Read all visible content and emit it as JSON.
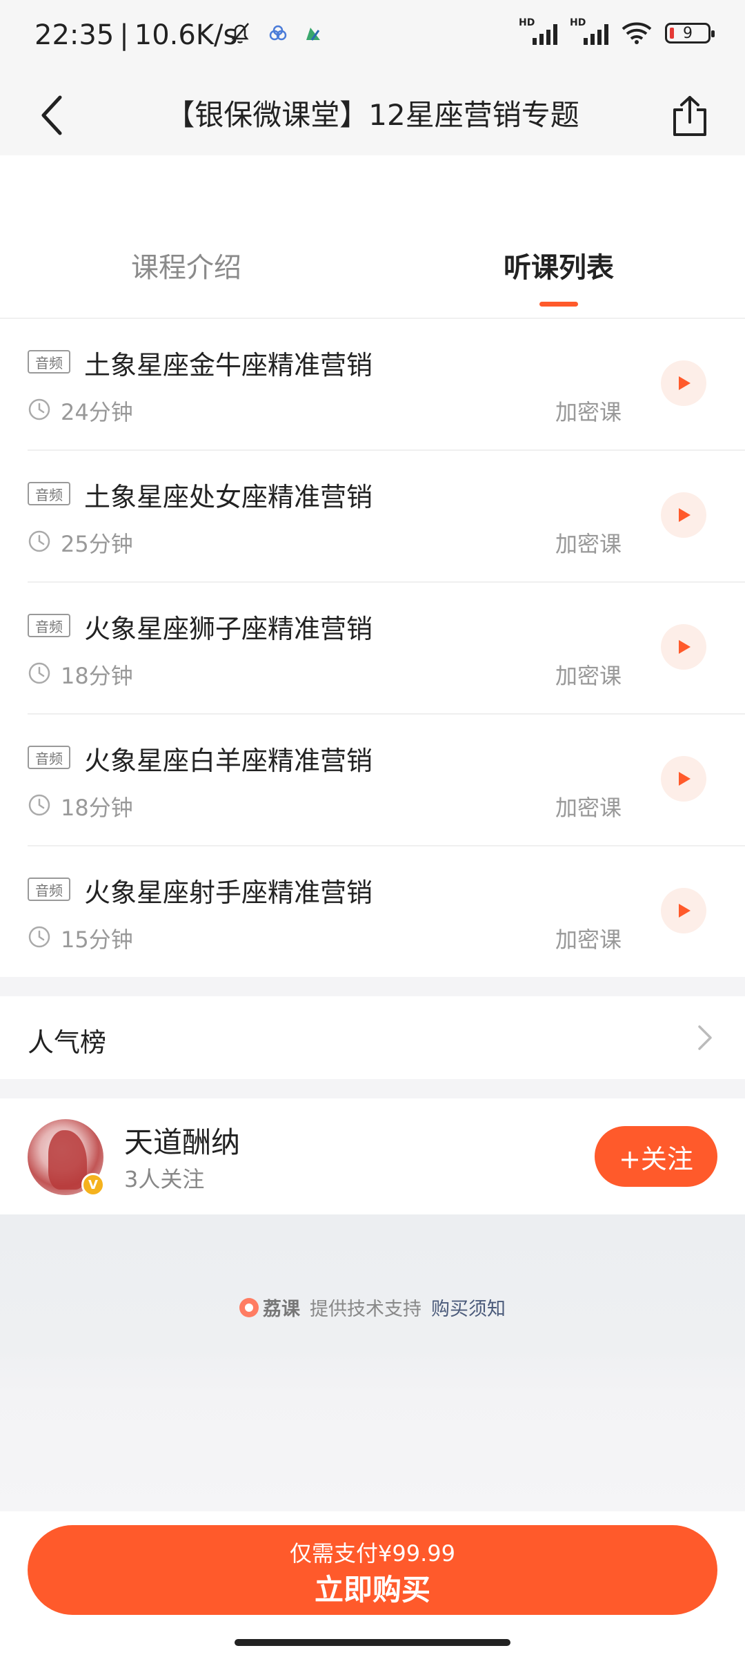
{
  "status_bar": {
    "time": "22:35",
    "network_speed": "10.6K/s",
    "battery_level": "9"
  },
  "header": {
    "title": "【银保微课堂】12星座营销专题"
  },
  "tabs": [
    {
      "label": "课程介绍",
      "active": false
    },
    {
      "label": "听课列表",
      "active": true
    }
  ],
  "lessons": [
    {
      "badge": "音频",
      "title": "土象星座金牛座精准营销",
      "duration": "24分钟",
      "tag": "加密课"
    },
    {
      "badge": "音频",
      "title": "土象星座处女座精准营销",
      "duration": "25分钟",
      "tag": "加密课"
    },
    {
      "badge": "音频",
      "title": "火象星座狮子座精准营销",
      "duration": "18分钟",
      "tag": "加密课"
    },
    {
      "badge": "音频",
      "title": "火象星座白羊座精准营销",
      "duration": "18分钟",
      "tag": "加密课"
    },
    {
      "badge": "音频",
      "title": "火象星座射手座精准营销",
      "duration": "15分钟",
      "tag": "加密课"
    }
  ],
  "popularity": {
    "label": "人气榜"
  },
  "author": {
    "name": "天道酬纳",
    "followers": "3人关注",
    "verified_badge": "V",
    "follow_label": "+关注"
  },
  "footer": {
    "brand": "荔课",
    "support_text": "提供技术支持",
    "notice_link": "购买须知"
  },
  "purchase": {
    "price_text": "仅需支付¥99.99",
    "button_label": "立即购买"
  },
  "colors": {
    "accent": "#ff5a2b",
    "play_bg": "#fdeee8"
  }
}
